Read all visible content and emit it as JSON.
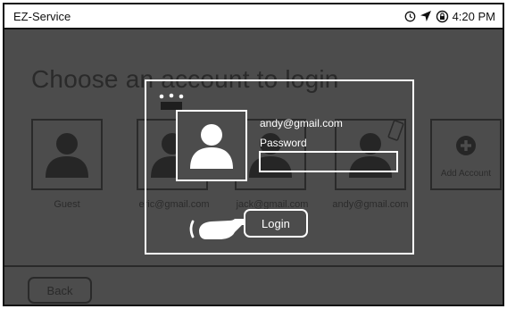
{
  "status_bar": {
    "app_title": "EZ-Service",
    "time": "4:20 PM",
    "icons": [
      "alarm-clock-icon",
      "location-arrow-icon",
      "rotation-lock-icon"
    ]
  },
  "background_screen": {
    "title": "Choose an account to login",
    "accounts": [
      {
        "label": "Guest",
        "icon": "person-icon"
      },
      {
        "label": "eric@gmail.com",
        "icon": "person-icon"
      },
      {
        "label": "jack@gmail.com",
        "icon": "person-icon"
      },
      {
        "label": "andy@gmail.com",
        "icon": "person-icon"
      }
    ],
    "add_account_label": "Add Account",
    "back_label": "Back"
  },
  "login_dialog": {
    "selected_email": "andy@gmail.com",
    "password_label": "Password",
    "password_value": "",
    "login_label": "Login",
    "badge_icon": "crown-icon",
    "device_icon": "phone-icon",
    "pointer_icon": "pointing-hand-icon"
  },
  "colors": {
    "overlay_background": "#4c4c4c",
    "dimmed_foreground": "#2a2a2a",
    "highlight": "#ffffff"
  }
}
